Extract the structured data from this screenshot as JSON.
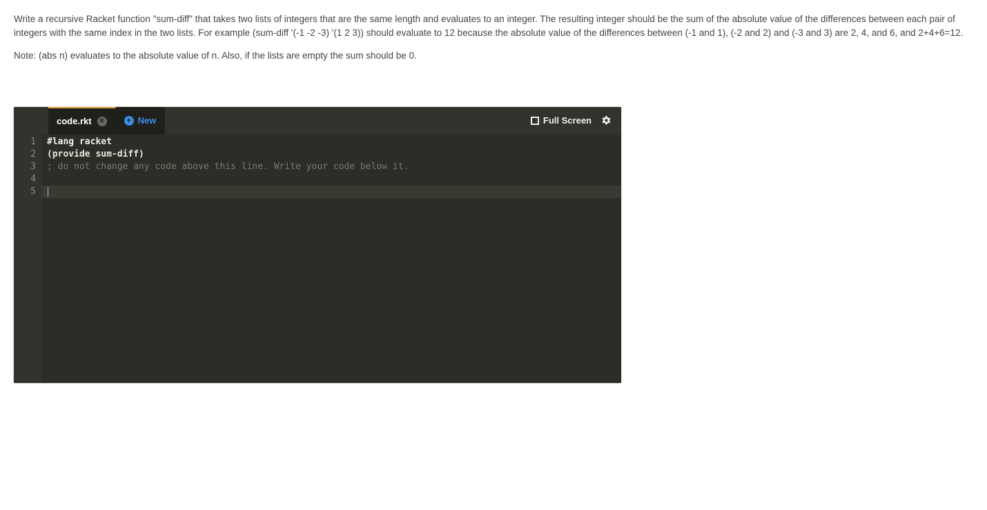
{
  "prompt": {
    "paragraph1": "Write a recursive Racket function \"sum-diff\" that takes two lists of integers that are the same length and evaluates to an integer. The resulting integer should be the sum of the absolute value of the differences between each pair of integers with the same index in the two lists. For example (sum-diff '(-1 -2 -3) '(1 2 3)) should evaluate to 12 because the absolute value of the differences between (-1 and 1), (-2 and 2) and (-3 and 3) are 2, 4, and 6, and 2+4+6=12.",
    "paragraph2": "Note: (abs n) evaluates to the absolute value of n. Also, if the lists are empty the sum should be 0."
  },
  "editor": {
    "tabs": {
      "active_filename": "code.rkt",
      "new_label": "New"
    },
    "toolbar": {
      "fullscreen_label": "Full Screen"
    },
    "gutter_lines": [
      "1",
      "2",
      "3",
      "4",
      "5"
    ],
    "code": {
      "line1_lang": "#lang racket",
      "line2_provide": "(provide sum-diff)",
      "line3_comment": "; do not change any code above this line. Write your code below it.",
      "line4": "",
      "line5": ""
    },
    "active_line_index": 5
  }
}
